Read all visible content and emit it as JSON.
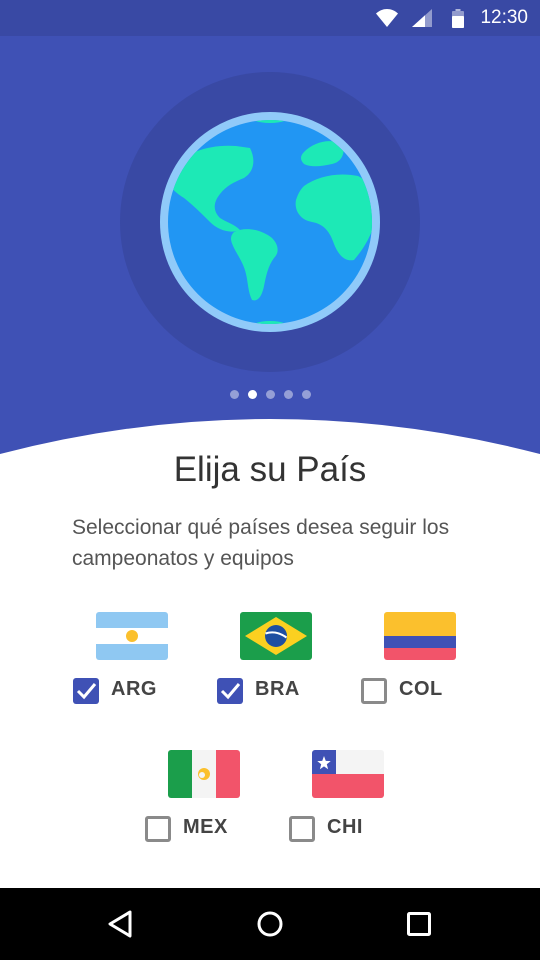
{
  "status_bar": {
    "time": "12:30",
    "icons": [
      "wifi-icon",
      "signal-icon",
      "battery-icon"
    ]
  },
  "onboarding": {
    "illustration": "globe-icon",
    "pager": {
      "total": 5,
      "active_index": 1
    },
    "title": "Elija su País",
    "subtitle": "Seleccionar qué países desea seguir los campeonatos y equipos"
  },
  "countries": [
    {
      "code": "ARG",
      "checked": true
    },
    {
      "code": "BRA",
      "checked": true
    },
    {
      "code": "COL",
      "checked": false
    },
    {
      "code": "MEX",
      "checked": false
    },
    {
      "code": "CHI",
      "checked": false
    }
  ],
  "navigation": [
    "back-icon",
    "home-icon",
    "recents-icon"
  ],
  "colors": {
    "primary": "#3f51b5",
    "primary_dark": "#3949a4",
    "globe_ocean": "#2196f3",
    "globe_land": "#1de9b6",
    "globe_ring": "#90caf9"
  }
}
